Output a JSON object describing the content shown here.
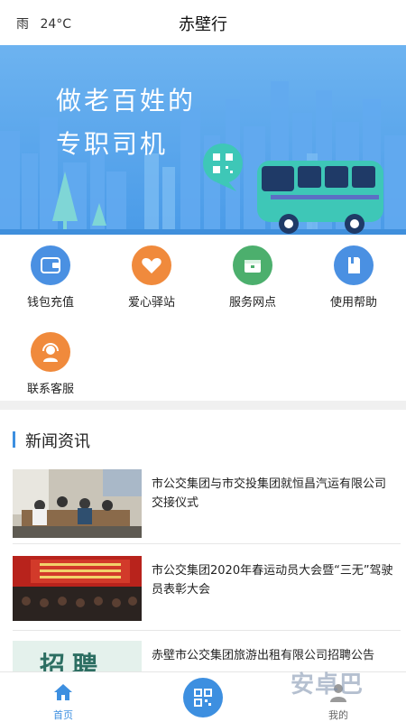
{
  "status": {
    "weather": "雨",
    "temperature": "24°C"
  },
  "header": {
    "title": "赤壁行"
  },
  "banner": {
    "line1": "做老百姓的",
    "line2": "专职司机"
  },
  "menu": [
    {
      "label": "钱包充值",
      "icon": "wallet-icon",
      "color": "#4a90e2"
    },
    {
      "label": "爱心驿站",
      "icon": "heart-icon",
      "color": "#f08a3c"
    },
    {
      "label": "服务网点",
      "icon": "box-icon",
      "color": "#4caf6d"
    },
    {
      "label": "使用帮助",
      "icon": "book-icon",
      "color": "#4a90e2"
    },
    {
      "label": "联系客服",
      "icon": "headset-icon",
      "color": "#f08a3c"
    }
  ],
  "news": {
    "title": "新闻资讯",
    "items": [
      {
        "text": "市公交集团与市交投集团就恒昌汽运有限公司交接仪式"
      },
      {
        "text": "市公交集团2020年春运动员大会暨“三无”驾驶员表彰大会"
      },
      {
        "text": "赤壁市公交集团旅游出租有限公司招聘公告"
      }
    ],
    "thumb3_text": "招聘"
  },
  "tabbar": {
    "home": "首页",
    "mine": "我的"
  },
  "watermark": "安卓巴",
  "colors": {
    "accent": "#3d8fe0",
    "banner_sky": "#5aa8ec",
    "bus": "#3ec7b7"
  }
}
